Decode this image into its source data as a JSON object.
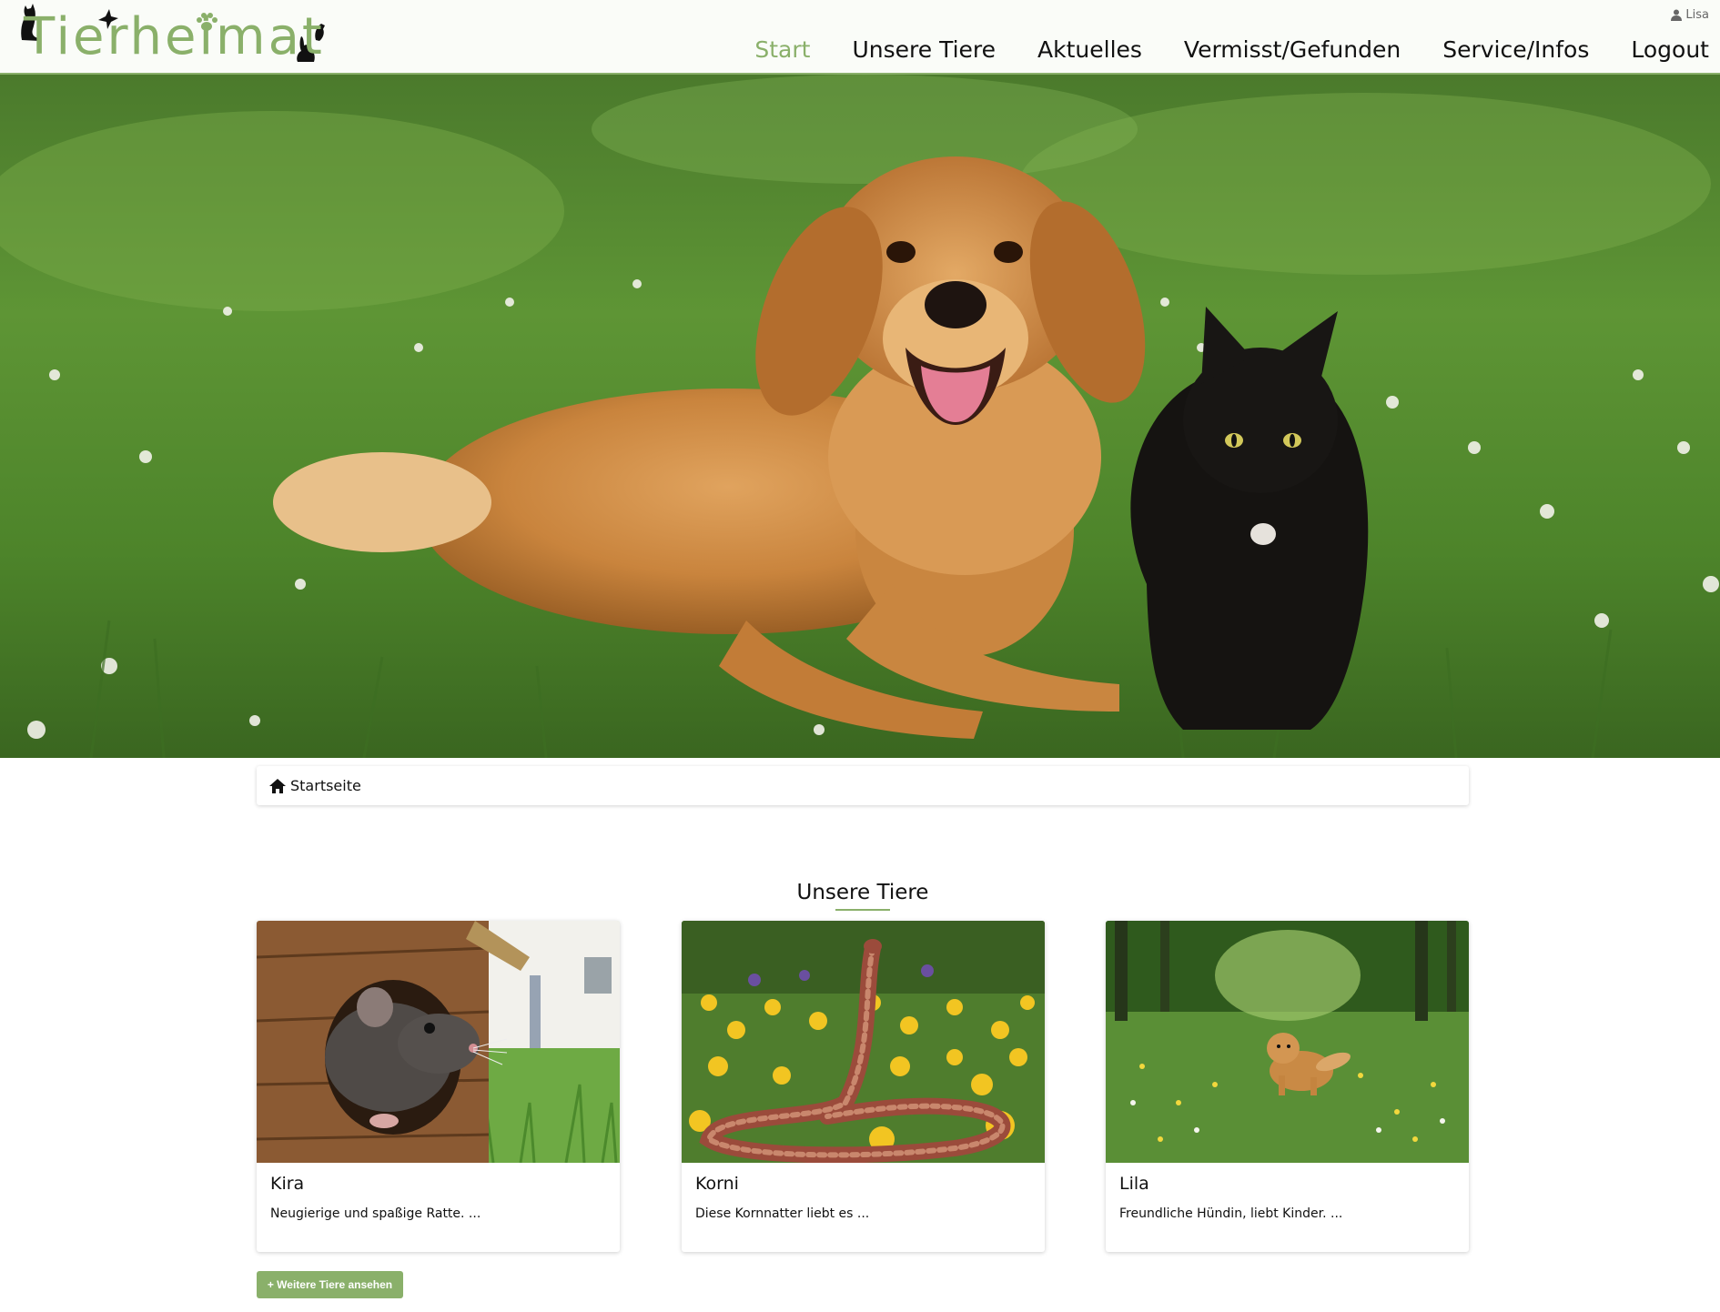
{
  "header": {
    "logo_text": "Tierheimat",
    "user_name": "Lisa",
    "nav": [
      {
        "label": "Start",
        "active": true
      },
      {
        "label": "Unsere Tiere",
        "active": false
      },
      {
        "label": "Aktuelles",
        "active": false
      },
      {
        "label": "Vermisst/Gefunden",
        "active": false
      },
      {
        "label": "Service/Infos",
        "active": false
      },
      {
        "label": "Logout",
        "active": false
      }
    ]
  },
  "colors": {
    "accent": "#8ab06a",
    "text": "#111111"
  },
  "hero": {
    "subject": "golden retriever and black cat lying in grass"
  },
  "breadcrumb": {
    "icon": "home-icon",
    "label": "Startseite"
  },
  "animals_section": {
    "title": "Unsere Tiere",
    "cards": [
      {
        "name": "Kira",
        "description": "Neugierige und spaßige Ratte. ..."
      },
      {
        "name": "Korni",
        "description": "Diese Kornnatter liebt es ..."
      },
      {
        "name": "Lila",
        "description": "Freundliche Hündin, liebt Kinder. ..."
      }
    ],
    "more_button": "+ Weitere Tiere ansehen"
  }
}
